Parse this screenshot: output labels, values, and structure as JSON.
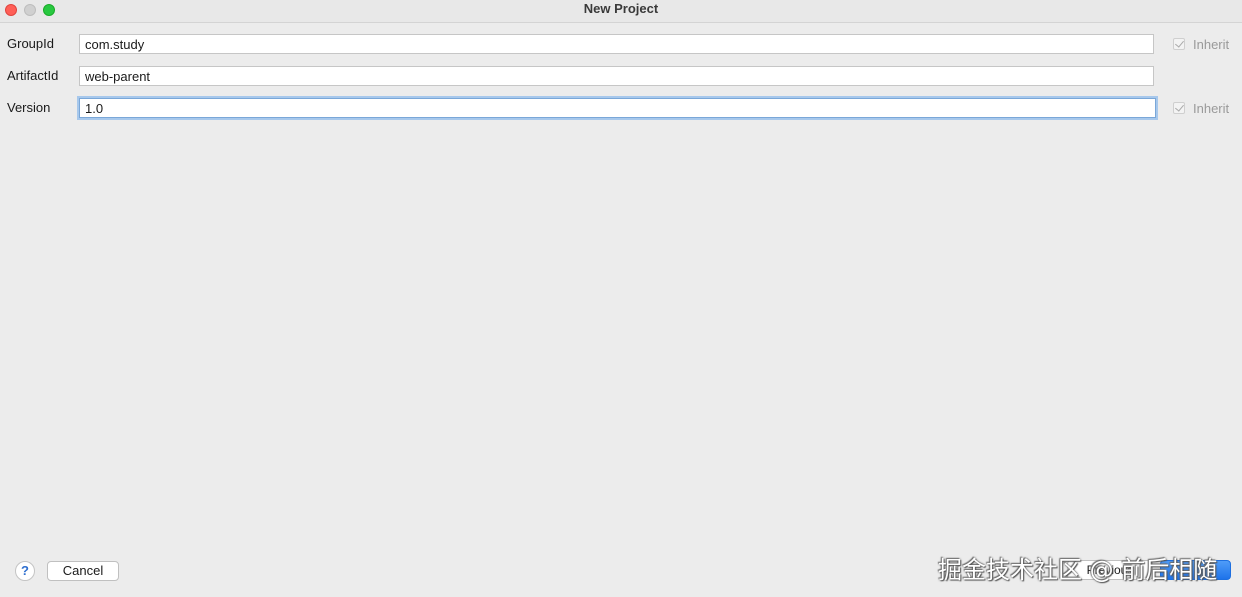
{
  "window": {
    "title": "New Project"
  },
  "form": {
    "group_id": {
      "label": "GroupId",
      "value": "com.study",
      "inherit_label": "Inherit",
      "inherit_checked": true
    },
    "artifact_id": {
      "label": "ArtifactId",
      "value": "web-parent"
    },
    "version": {
      "label": "Version",
      "value": "1.0",
      "inherit_label": "Inherit",
      "inherit_checked": true
    }
  },
  "footer": {
    "help_label": "?",
    "cancel_label": "Cancel",
    "previous_label": "Previous",
    "next_label": ""
  },
  "watermark": {
    "text": "掘金技术社区 @ 前后相随"
  },
  "colors": {
    "background": "#ececec",
    "accent": "#1e73ea",
    "focus_ring": "#a7c8ec"
  }
}
